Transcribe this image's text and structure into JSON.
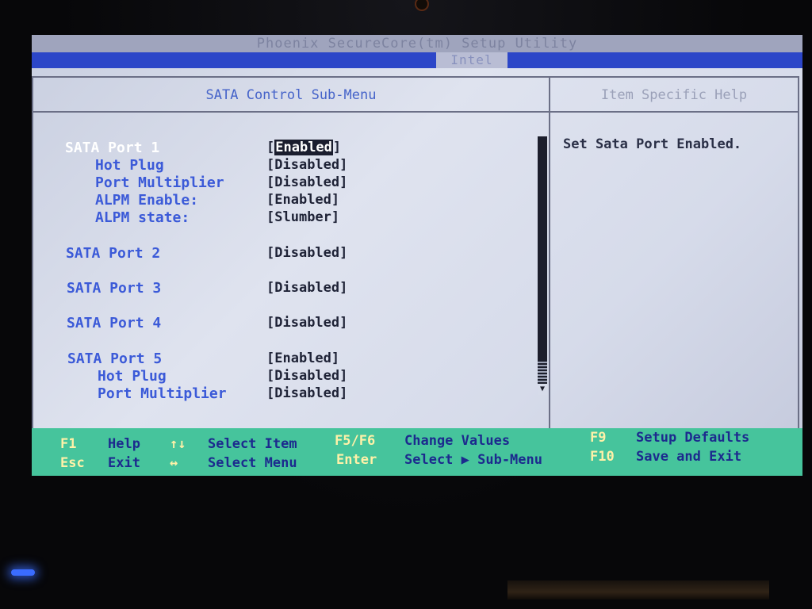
{
  "title": "Phoenix SecureCore(tm) Setup Utility",
  "tab": "Intel",
  "main_header": "SATA Control Sub-Menu",
  "help_header": "Item Specific Help",
  "help_text": "Set Sata Port Enabled.",
  "settings": [
    {
      "label": "SATA Port 1",
      "value": "Enabled",
      "selected": true
    },
    {
      "label": "Hot Plug",
      "value": "Disabled"
    },
    {
      "label": "Port Multiplier",
      "value": "Disabled"
    },
    {
      "label": "ALPM Enable:",
      "value": "Enabled"
    },
    {
      "label": "ALPM state:",
      "value": "Slumber"
    },
    {
      "label": "SATA Port 2",
      "value": "Disabled"
    },
    {
      "label": "SATA Port 3",
      "value": "Disabled"
    },
    {
      "label": "SATA Port 4",
      "value": "Disabled"
    },
    {
      "label": "SATA Port 5",
      "value": "Enabled"
    },
    {
      "label": "Hot Plug",
      "value": "Disabled"
    },
    {
      "label": "Port Multiplier",
      "value": "Disabled"
    }
  ],
  "footer": {
    "f1_key": "F1",
    "f1_desc": "Help",
    "esc_key": "Esc",
    "esc_desc": "Exit",
    "ud_key": "↑↓",
    "ud_desc": "Select Item",
    "lr_key": "↔",
    "lr_desc": "Select Menu",
    "f5f6_key": "F5/F6",
    "f5f6_desc": "Change Values",
    "enter_key": "Enter",
    "enter_desc": "Select ▶ Sub-Menu",
    "f9_key": "F9",
    "f9_desc": "Setup Defaults",
    "f10_key": "F10",
    "f10_desc": "Save and Exit"
  },
  "colors": {
    "tab_bar": "#2c46c8",
    "label": "#3b5ad8",
    "active_label": "#ffffff",
    "footer_bg": "#46c49c",
    "footer_key": "#fff1a8",
    "footer_desc": "#1c2a8e"
  }
}
